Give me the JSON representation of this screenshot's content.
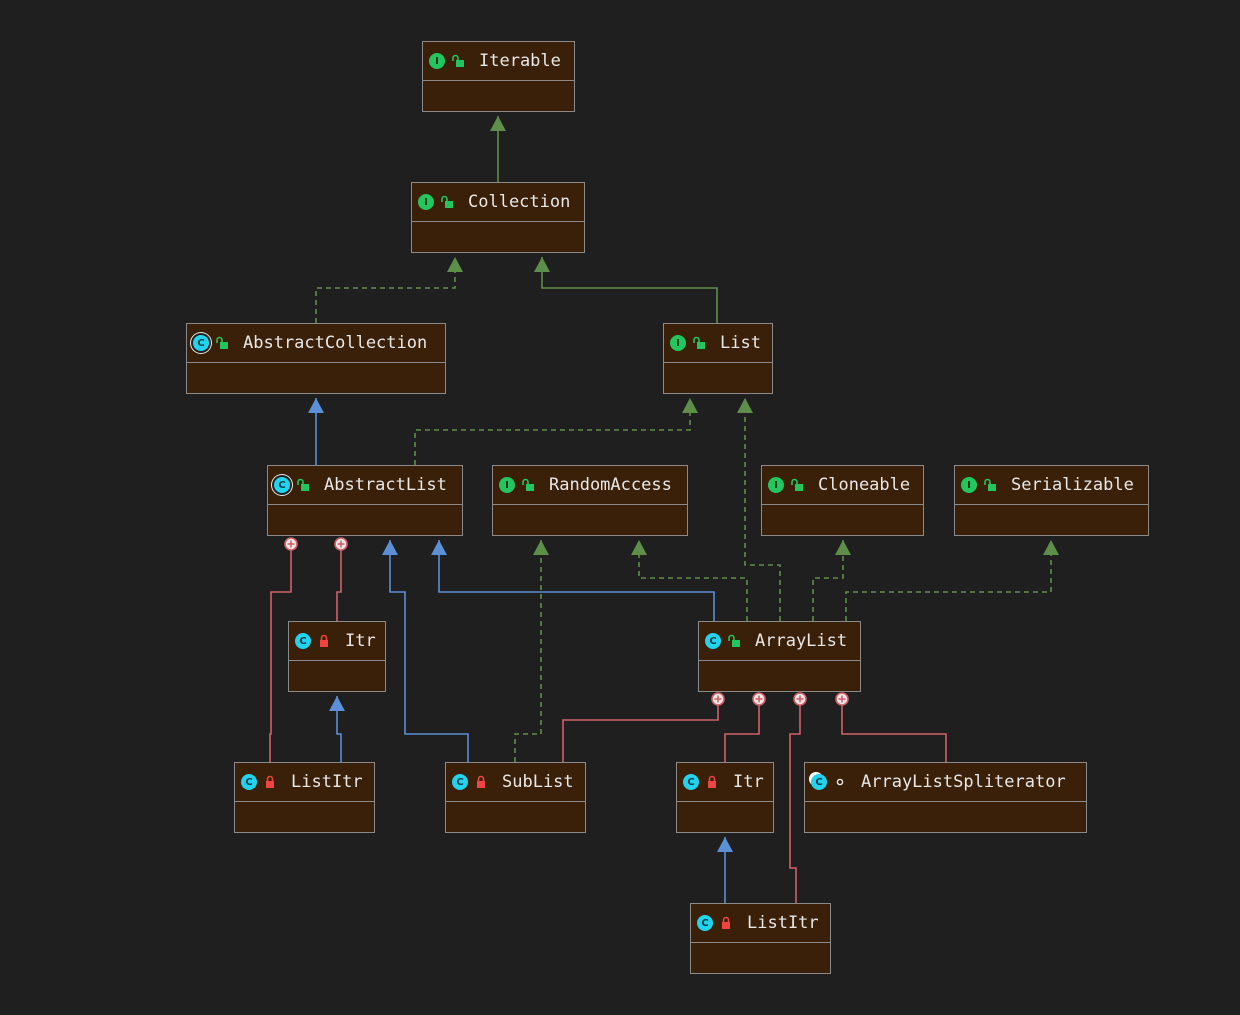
{
  "diagram": {
    "nodes": [
      {
        "id": "iterable",
        "label": "Iterable",
        "kind": "interface",
        "kind_letter": "I",
        "visibility": "public"
      },
      {
        "id": "collection",
        "label": "Collection",
        "kind": "interface",
        "kind_letter": "I",
        "visibility": "public"
      },
      {
        "id": "abstract-collection",
        "label": "AbstractCollection",
        "kind": "abstract",
        "kind_letter": "C",
        "visibility": "public"
      },
      {
        "id": "list",
        "label": "List",
        "kind": "interface",
        "kind_letter": "I",
        "visibility": "public"
      },
      {
        "id": "abstract-list",
        "label": "AbstractList",
        "kind": "abstract",
        "kind_letter": "C",
        "visibility": "public"
      },
      {
        "id": "random-access",
        "label": "RandomAccess",
        "kind": "interface",
        "kind_letter": "I",
        "visibility": "public"
      },
      {
        "id": "cloneable",
        "label": "Cloneable",
        "kind": "interface",
        "kind_letter": "I",
        "visibility": "public"
      },
      {
        "id": "serializable",
        "label": "Serializable",
        "kind": "interface",
        "kind_letter": "I",
        "visibility": "public"
      },
      {
        "id": "itr-a",
        "label": "Itr",
        "kind": "class",
        "kind_letter": "C",
        "visibility": "private"
      },
      {
        "id": "arraylist",
        "label": "ArrayList",
        "kind": "class",
        "kind_letter": "C",
        "visibility": "public"
      },
      {
        "id": "listitr-a",
        "label": "ListItr",
        "kind": "class",
        "kind_letter": "C",
        "visibility": "private"
      },
      {
        "id": "sublist",
        "label": "SubList",
        "kind": "class",
        "kind_letter": "C",
        "visibility": "private"
      },
      {
        "id": "itr-b",
        "label": "Itr",
        "kind": "class",
        "kind_letter": "C",
        "visibility": "private"
      },
      {
        "id": "spliterator",
        "label": "ArrayListSpliterator",
        "kind": "static",
        "kind_letter": "C",
        "visibility": "package"
      },
      {
        "id": "listitr-b",
        "label": "ListItr",
        "kind": "class",
        "kind_letter": "C",
        "visibility": "private"
      }
    ],
    "edges": [
      {
        "from": "collection",
        "to": "iterable",
        "type": "extends"
      },
      {
        "from": "abstract-collection",
        "to": "collection",
        "type": "implements"
      },
      {
        "from": "list",
        "to": "collection",
        "type": "extends"
      },
      {
        "from": "abstract-list",
        "to": "abstract-collection",
        "type": "class-extends"
      },
      {
        "from": "abstract-list",
        "to": "list",
        "type": "implements"
      },
      {
        "from": "arraylist",
        "to": "list",
        "type": "implements"
      },
      {
        "from": "arraylist",
        "to": "abstract-list",
        "type": "class-extends"
      },
      {
        "from": "arraylist",
        "to": "random-access",
        "type": "implements"
      },
      {
        "from": "arraylist",
        "to": "cloneable",
        "type": "implements"
      },
      {
        "from": "arraylist",
        "to": "serializable",
        "type": "implements"
      },
      {
        "from": "sublist",
        "to": "random-access",
        "type": "implements"
      },
      {
        "from": "sublist",
        "to": "abstract-list",
        "type": "class-extends"
      },
      {
        "from": "listitr-a",
        "to": "itr-a",
        "type": "class-extends"
      },
      {
        "from": "listitr-b",
        "to": "itr-b",
        "type": "class-extends"
      },
      {
        "from": "abstract-list",
        "to": "listitr-a",
        "type": "inner"
      },
      {
        "from": "abstract-list",
        "to": "itr-a",
        "type": "inner"
      },
      {
        "from": "arraylist",
        "to": "sublist",
        "type": "inner"
      },
      {
        "from": "arraylist",
        "to": "itr-b",
        "type": "inner"
      },
      {
        "from": "arraylist",
        "to": "listitr-b",
        "type": "inner"
      },
      {
        "from": "arraylist",
        "to": "spliterator",
        "type": "inner"
      }
    ],
    "colors": {
      "background": "#1f1f1f",
      "node_fill": "#3a2008",
      "node_border": "#8a8a8a",
      "interface_extends": "#5e8f4a",
      "class_extends": "#5b8fd6",
      "inner_class": "#d1606a",
      "text": "#e8e8e8"
    }
  }
}
